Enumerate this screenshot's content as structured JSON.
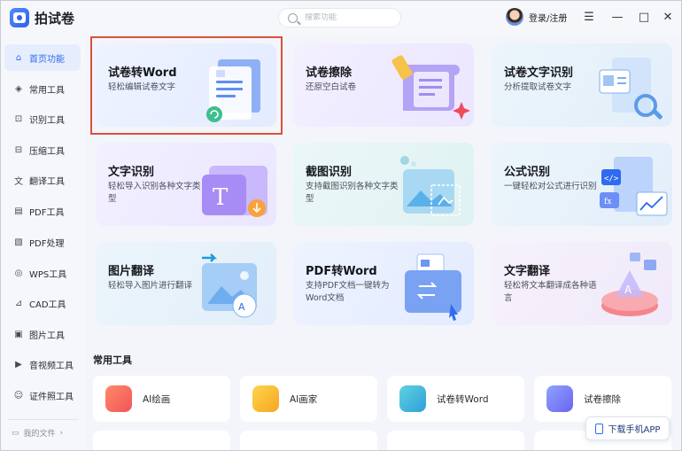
{
  "app": {
    "name": "拍试卷"
  },
  "search": {
    "placeholder": "搜索功能"
  },
  "user": {
    "login_label": "登录/注册"
  },
  "window_controls": {
    "menu": "☰",
    "minimize": "—",
    "maximize": "□",
    "close": "✕"
  },
  "sidebar": {
    "items": [
      {
        "label": "首页功能",
        "icon": "home-icon",
        "active": true
      },
      {
        "label": "常用工具",
        "icon": "layers-icon"
      },
      {
        "label": "识别工具",
        "icon": "scan-icon"
      },
      {
        "label": "压缩工具",
        "icon": "compress-icon"
      },
      {
        "label": "翻译工具",
        "icon": "translate-icon"
      },
      {
        "label": "PDF工具",
        "icon": "pdf-icon"
      },
      {
        "label": "PDF处理",
        "icon": "pdf-process-icon"
      },
      {
        "label": "WPS工具",
        "icon": "wps-icon"
      },
      {
        "label": "CAD工具",
        "icon": "cad-icon"
      },
      {
        "label": "图片工具",
        "icon": "image-icon"
      },
      {
        "label": "音视频工具",
        "icon": "video-icon"
      },
      {
        "label": "证件照工具",
        "icon": "id-photo-icon"
      }
    ],
    "my_files": "我的文件"
  },
  "cards": [
    {
      "title": "试卷转Word",
      "desc": "轻松编辑试卷文字"
    },
    {
      "title": "试卷擦除",
      "desc": "还原空白试卷"
    },
    {
      "title": "试卷文字识别",
      "desc": "分析提取试卷文字"
    },
    {
      "title": "文字识别",
      "desc": "轻松导入识别各种文字类型"
    },
    {
      "title": "截图识别",
      "desc": "支持截图识别各种文字类型"
    },
    {
      "title": "公式识别",
      "desc": "一键轻松对公式进行识别"
    },
    {
      "title": "图片翻译",
      "desc": "轻松导入图片进行翻译"
    },
    {
      "title": "PDF转Word",
      "desc": "支持PDF文档一键转为Word文档"
    },
    {
      "title": "文字翻译",
      "desc": "轻松将文本翻译成各种语言"
    }
  ],
  "common_tools": {
    "title": "常用工具",
    "items": [
      {
        "label": "AI绘画",
        "icon": "ai-paint-icon"
      },
      {
        "label": "AI画家",
        "icon": "ai-painter-icon"
      },
      {
        "label": "试卷转Word",
        "icon": "word-icon"
      },
      {
        "label": "试卷擦除",
        "icon": "eraser-icon"
      }
    ]
  },
  "download_app": {
    "label": "下载手机APP"
  },
  "colors": {
    "accent": "#2f6bf0",
    "highlight": "#d9523c"
  }
}
